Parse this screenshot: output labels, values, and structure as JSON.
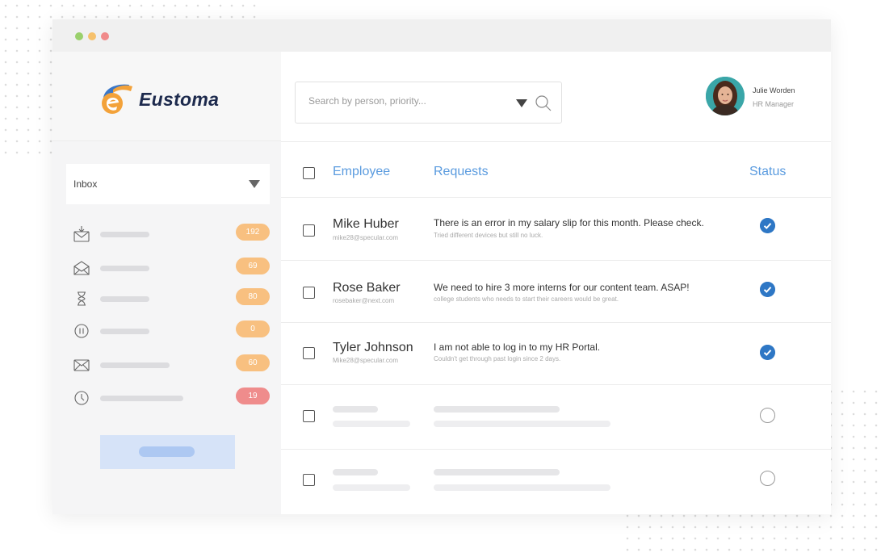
{
  "colors": {
    "accent": "#5a9bdf",
    "check": "#2e77c5",
    "badge_orange": "#f8c080",
    "badge_red": "#ef8c8c",
    "dot_green": "#9ad06c",
    "dot_yellow": "#f6c16c",
    "dot_red": "#f08a8a"
  },
  "brand": {
    "name": "Eustoma"
  },
  "sidebar": {
    "folder_select": "Inbox",
    "items": [
      {
        "icon": "inbox-download-icon",
        "badge": "192",
        "badge_color": "orange"
      },
      {
        "icon": "open-envelope-icon",
        "badge": "69",
        "badge_color": "orange"
      },
      {
        "icon": "hourglass-icon",
        "badge": "80",
        "badge_color": "orange"
      },
      {
        "icon": "pause-icon",
        "badge": "0",
        "badge_color": "orange"
      },
      {
        "icon": "envelope-icon",
        "badge": "60",
        "badge_color": "orange"
      },
      {
        "icon": "clock-icon",
        "badge": "19",
        "badge_color": "red"
      }
    ]
  },
  "search": {
    "placeholder": "Search by person, priority..."
  },
  "profile": {
    "name": "Julie Worden",
    "role": "HR Manager"
  },
  "table": {
    "headers": {
      "employee": "Employee",
      "requests": "Requests",
      "status": "Status"
    },
    "rows": [
      {
        "name": "Mike Huber",
        "email": "mike28@specular.com",
        "request": "There is an error in my salary slip for this month. Please check.",
        "detail": "Tried different devices but still no luck.",
        "status": "done"
      },
      {
        "name": "Rose Baker",
        "email": "rosebaker@next.com",
        "request": "We need to hire 3 more interns for our content team. ASAP!",
        "detail": "college students who needs to start their careers would be great.",
        "status": "done"
      },
      {
        "name": "Tyler Johnson",
        "email": "Mike28@specular.com",
        "request": "I am not able to log in to my HR Portal.",
        "detail": "Couldn't get through past login since 2 days.",
        "status": "done"
      }
    ]
  }
}
